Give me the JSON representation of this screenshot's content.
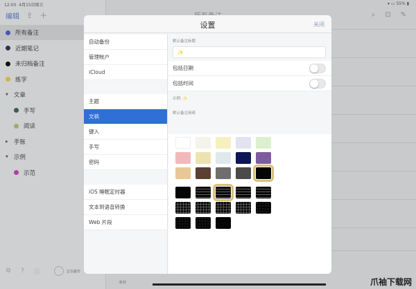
{
  "status": {
    "time": "12:00",
    "date": "4月15日周三",
    "battery": "55%"
  },
  "sidebar": {
    "edit": "编辑",
    "items": [
      {
        "label": "所有备注",
        "color": "#4a55b5"
      },
      {
        "label": "近期笔记",
        "color": "#2f3440"
      },
      {
        "label": "未归档备注",
        "color": "#111111"
      },
      {
        "label": "练字",
        "color": "#d4b24a"
      },
      {
        "label": "文章",
        "group": true
      },
      {
        "label": "手写",
        "color": "#3d5a50"
      },
      {
        "label": "阅读",
        "color": "#95b06a"
      },
      {
        "label": "手账",
        "group": true
      },
      {
        "label": "示例",
        "group": true
      },
      {
        "label": "示范",
        "color": "#b040a8"
      }
    ],
    "sync": "正在备份"
  },
  "main": {
    "title": "所有备注",
    "bottom_label": "新材"
  },
  "watermark": "爪袖下载网",
  "modal": {
    "title": "设置",
    "close": "关闭",
    "left": [
      "自动备份",
      "管理帐户",
      "iCloud",
      "主题",
      "文稿",
      "键入",
      "手写",
      "密码",
      "iOS 睡眠定时器",
      "文本到语音转换",
      "Web 片段"
    ],
    "selected": "文稿",
    "default_title_label": "默认备注标题",
    "default_title_value": "✨",
    "include_date": "包括日期",
    "include_date_on": false,
    "include_time": "包括时间",
    "include_time_on": false,
    "example_label": "示例:",
    "example_value": "✨",
    "paper_label": "默认备注用纸",
    "colors": [
      "#ffffff",
      "#f4f3ec",
      "#f6efbf",
      "#e2e3f0",
      "#dcefcf",
      "#f2b9bb",
      "#ece3b0",
      "#dfe9ec",
      "#0b1755",
      "#7c5c9e",
      "#e9c896",
      "#5a3f33",
      "#6e6e6e",
      "#4a4a4a",
      "#050505"
    ],
    "patterns": [
      "plain",
      "lines",
      "lines",
      "lines",
      "lines",
      "grid",
      "grid",
      "grid",
      "grid",
      "dots",
      "dots",
      "dots",
      "plain"
    ]
  }
}
